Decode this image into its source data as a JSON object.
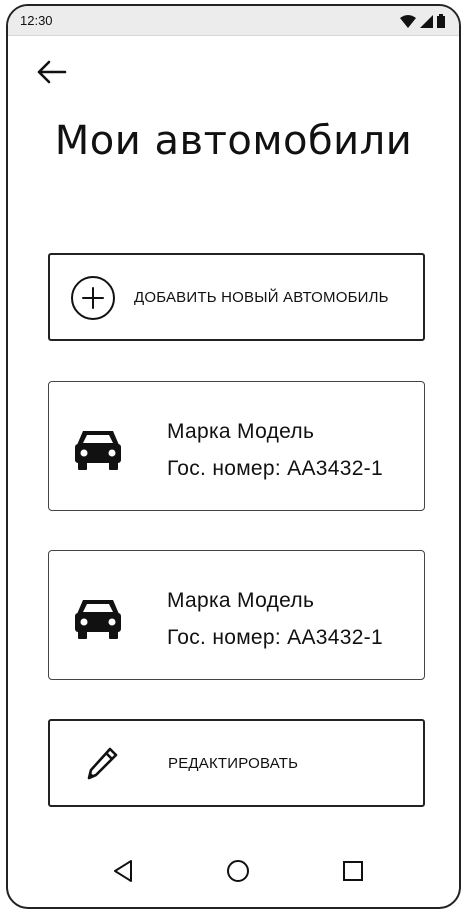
{
  "status_bar": {
    "time": "12:30"
  },
  "header": {
    "title": "Мои автомобили"
  },
  "add_car": {
    "label": "ДОБАВИТЬ НОВЫЙ АВТОМОБИЛЬ",
    "icon": "plus-circle-icon"
  },
  "cars": [
    {
      "name": "Марка Модель",
      "plate": "Гос. номер: АА3432-1",
      "icon": "car-icon"
    },
    {
      "name": "Марка Модель",
      "plate": "Гос. номер: АА3432-1",
      "icon": "car-icon"
    }
  ],
  "edit": {
    "label": "РЕДАКТИРОВАТЬ",
    "icon": "pencil-icon"
  },
  "navigation": {
    "buttons": [
      "back-triangle-icon",
      "home-circle-icon",
      "recents-square-icon"
    ]
  }
}
